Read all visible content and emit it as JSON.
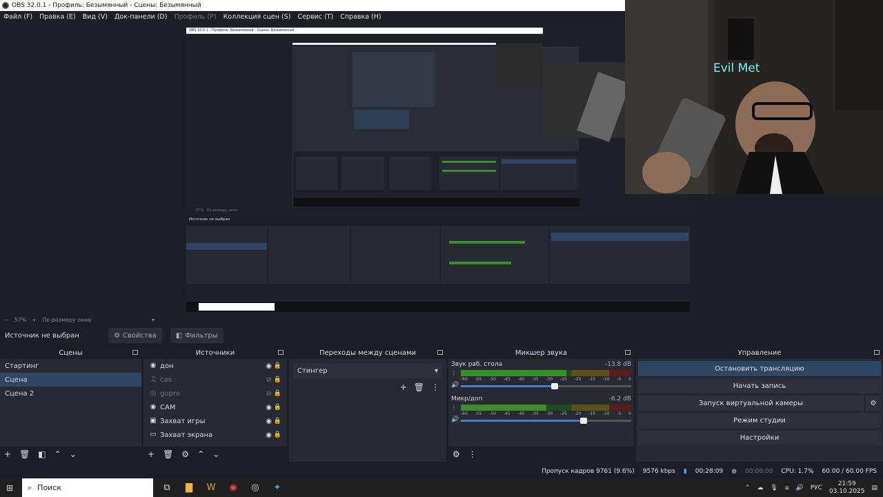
{
  "window": {
    "title": "OBS 32.0.1 - Профиль: Безымянный - Сцены: Безымянный"
  },
  "menu": [
    "Файл (F)",
    "Правка (E)",
    "Вид (V)",
    "Док-панели (D)",
    "Профиль (P)",
    "Коллекция сцен (S)",
    "Сервис (T)",
    "Справка (H)"
  ],
  "menu_disabled_index": 4,
  "webcam": {
    "sign_text": "Evil Met"
  },
  "nested": {
    "title": "OBS 32.0.1 - Профиль: Безымянный - Сцены: Безымянный",
    "source_none": "Источник не выбран",
    "zoom": "57%",
    "fit": "По размеру окна"
  },
  "zoombar": {
    "minus": "−",
    "zoom": "57%",
    "plus": "+",
    "fit": "По размеру окна"
  },
  "source_bar": {
    "none_selected": "Источник не выбран",
    "properties": "Свойства",
    "filters": "Фильтры"
  },
  "scenes": {
    "title": "Сцены",
    "items": [
      "Стартинг",
      "Сцена",
      "Сцена 2"
    ],
    "selected": 1
  },
  "sources": {
    "title": "Источники",
    "items": [
      {
        "name": "дон",
        "icon": "◉",
        "visible": true
      },
      {
        "name": "cas",
        "icon": "♫",
        "visible": false
      },
      {
        "name": "gopro",
        "icon": "◎",
        "visible": false
      },
      {
        "name": "CAM",
        "icon": "◉",
        "visible": true
      },
      {
        "name": "Захват игры",
        "icon": "▣",
        "visible": true
      },
      {
        "name": "Захват экрана",
        "icon": "▭",
        "visible": true
      }
    ]
  },
  "transitions": {
    "title": "Переходы между сценами",
    "selected": "Стингер"
  },
  "mixer": {
    "title": "Микшер звука",
    "channels": [
      {
        "name": "Звук раб. стола",
        "db": "-13.8 dB",
        "level": 0.62,
        "volume": 0.55
      },
      {
        "name": "Микр/доп",
        "db": "-6.2 dB",
        "level": 0.5,
        "volume": 0.72
      }
    ],
    "scale": [
      "-60",
      "-55",
      "-50",
      "-45",
      "-40",
      "-35",
      "-30",
      "-25",
      "-20",
      "-15",
      "-10",
      "-5",
      "0"
    ]
  },
  "controls": {
    "title": "Управление",
    "buttons": [
      "Остановить трансляцию",
      "Начать запись",
      "Запуск виртуальной камеры",
      "Режим студии",
      "Настройки"
    ]
  },
  "status": {
    "dropped": "Пропуск кадров 9761 (9.6%)",
    "bitrate": "9576 kbps",
    "stream_time": "00:28:09",
    "rec_time": "00:00:00",
    "cpu": "CPU: 1.7%",
    "fps": "60.00 / 60.00 FPS"
  },
  "taskbar": {
    "search": "Поиск",
    "lang": "РУС",
    "time": "21:59",
    "date": "03.10.2025"
  },
  "colors": {
    "accent": "#2f4662",
    "dock_bg": "#272a33",
    "meter_green": "#3a8f2a"
  }
}
